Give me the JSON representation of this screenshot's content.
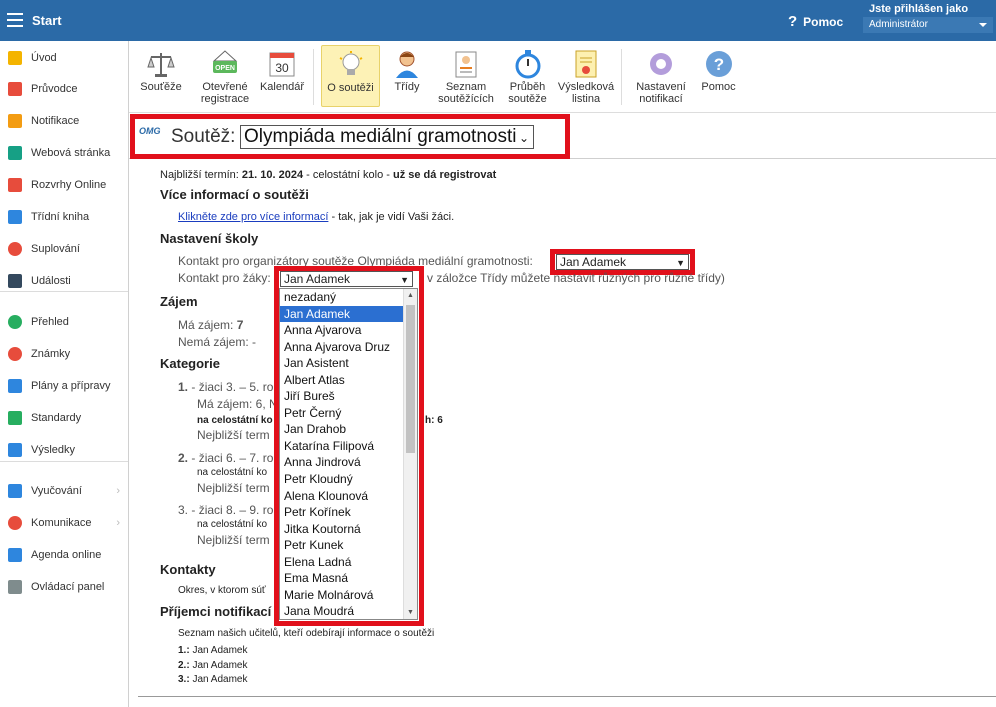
{
  "topbar": {
    "title": "Start",
    "help": "Pomoc",
    "user_label": "Jste přihlášen jako",
    "user_role": "Administrátor"
  },
  "sidebar": {
    "items": [
      {
        "label": "Úvod",
        "icon": "star-icon",
        "color": "#f4b400"
      },
      {
        "label": "Průvodce",
        "icon": "wand-icon",
        "color": "#e74c3c"
      },
      {
        "label": "Notifikace",
        "icon": "mail-icon",
        "color": "#f39c12"
      },
      {
        "label": "Webová stránka",
        "icon": "home-icon",
        "color": "#16a085"
      },
      {
        "label": "Rozvrhy Online",
        "icon": "calendar-icon",
        "color": "#e74c3c"
      },
      {
        "label": "Třídní kniha",
        "icon": "book-icon",
        "color": "#2e86de"
      },
      {
        "label": "Suplování",
        "icon": "person-icon",
        "color": "#e74c3c"
      },
      {
        "label": "Události",
        "icon": "events-icon",
        "color": "#34495e"
      },
      {
        "label": "Přehled",
        "icon": "check-icon",
        "color": "#27ae60"
      },
      {
        "label": "Známky",
        "icon": "grade-icon",
        "color": "#e74c3c"
      },
      {
        "label": "Plány a přípravy",
        "icon": "briefcase-icon",
        "color": "#2e86de"
      },
      {
        "label": "Standardy",
        "icon": "shield-icon",
        "color": "#27ae60"
      },
      {
        "label": "Výsledky",
        "icon": "chart-icon",
        "color": "#2e86de"
      },
      {
        "label": "Vyučování",
        "icon": "teaching-icon",
        "color": "#2e86de"
      },
      {
        "label": "Komunikace",
        "icon": "chat-icon",
        "color": "#e74c3c"
      },
      {
        "label": "Agenda online",
        "icon": "pen-icon",
        "color": "#2e86de"
      },
      {
        "label": "Ovládací panel",
        "icon": "gear-icon",
        "color": "#7f8c8d"
      }
    ]
  },
  "toolbar": {
    "items": [
      {
        "label": "Souťěže",
        "l2": "",
        "icon": "scales-icon"
      },
      {
        "label": "Otevřené",
        "l2": "registrace",
        "icon": "open-sign-icon",
        "badge": "OPEN"
      },
      {
        "label": "Kalendář",
        "l2": "",
        "icon": "calendar-icon",
        "badge": "30"
      },
      {
        "label": "O soutěži",
        "l2": "",
        "icon": "bulb-icon"
      },
      {
        "label": "Třídy",
        "l2": "",
        "icon": "student-icon"
      },
      {
        "label": "Seznam",
        "l2": "soutěžících",
        "icon": "badge-list-icon"
      },
      {
        "label": "Průběh",
        "l2": "soutěže",
        "icon": "stopwatch-icon"
      },
      {
        "label": "Výsledková",
        "l2": "listina",
        "icon": "certificate-icon"
      },
      {
        "label": "Nastavení",
        "l2": "notifikací",
        "icon": "gear-icon"
      },
      {
        "label": "Pomoc",
        "l2": "",
        "icon": "help-icon"
      }
    ]
  },
  "competition": {
    "logo": "OMG",
    "label": "Soutěž:",
    "selected": "Olympiáda mediální gramotnosti"
  },
  "main": {
    "deadline_prefix": "Najbližší termín:",
    "deadline_date": "21. 10. 2024",
    "deadline_mid": "- celostátní kolo -",
    "deadline_status": "už se dá registrovat",
    "more_info_heading": "Více informací o soutěži",
    "more_info_link": "Klikněte zde pro více informací",
    "more_info_rest": "- tak, jak je vidí Vaši žáci.",
    "school_heading": "Nastavení školy",
    "organizer_label": "Kontakt pro organizátory soutěže Olympiáda mediální gramotnosti:",
    "organizer_value": "Jan Adamek",
    "pupils_label": "Kontakt pro žáky:",
    "pupils_value": "Jan Adamek",
    "pupils_hint": "v záložce Třídy můžete nastavit různých pro různé třídy)",
    "interest_heading": "Zájem",
    "interest_yes_label": "Má zájem:",
    "interest_yes_value": "7",
    "interest_no_label": "Nemá zájem:",
    "interest_no_value": "-",
    "categories_heading": "Kategorie",
    "cat1_num": "1.",
    "cat1_text": "- žiaci 3. – 5. ro",
    "cat1_interest": "Má zájem: 6, N",
    "cat1_final": "na celostátní ko",
    "cat1_final_tail": "h: 6",
    "cat1_term": "Nejbližší term",
    "cat2_num": "2.",
    "cat2_text": "- žiaci 6. – 7. ro",
    "cat2_final": "na celostátní ko",
    "cat2_term": "Nejbližší term",
    "cat3_num": "3.",
    "cat3_text": "- žiaci 8. – 9. ro",
    "cat3_final": "na celostátní ko",
    "cat3_term": "Nejbližší term",
    "contacts_heading": "Kontakty",
    "contacts_text": "Okres, v ktorom súť",
    "recipients_heading": "Příjemci notifikací",
    "recipients_text": "Seznam našich učitelů, kteří odebírají informace o soutěži",
    "recipients": [
      {
        "num": "1.:",
        "name": "Jan Adamek"
      },
      {
        "num": "2.:",
        "name": "Jan Adamek"
      },
      {
        "num": "3.:",
        "name": "Jan Adamek"
      }
    ]
  },
  "dropdown": {
    "options": [
      "nezadaný",
      "Jan Adamek",
      "Anna Ajvarova",
      "Anna Ajvarova Druz",
      "Jan Asistent",
      "Albert Atlas",
      "Jiří Bureš",
      "Petr Černý",
      "Jan Drahob",
      "Katarína Filipová",
      "Anna Jindrová",
      "Petr Kloudný",
      "Alena Klounová",
      "Petr Kořínek",
      "Jitka Koutorná",
      "Petr Kunek",
      "Elena Ladná",
      "Ema Masná",
      "Marie Molnárová",
      "Jana Moudrá"
    ],
    "selected_index": 1
  },
  "colors": {
    "topbar": "#2b6aa7",
    "highlight": "#e1101b",
    "selection": "#2b6fd1"
  }
}
